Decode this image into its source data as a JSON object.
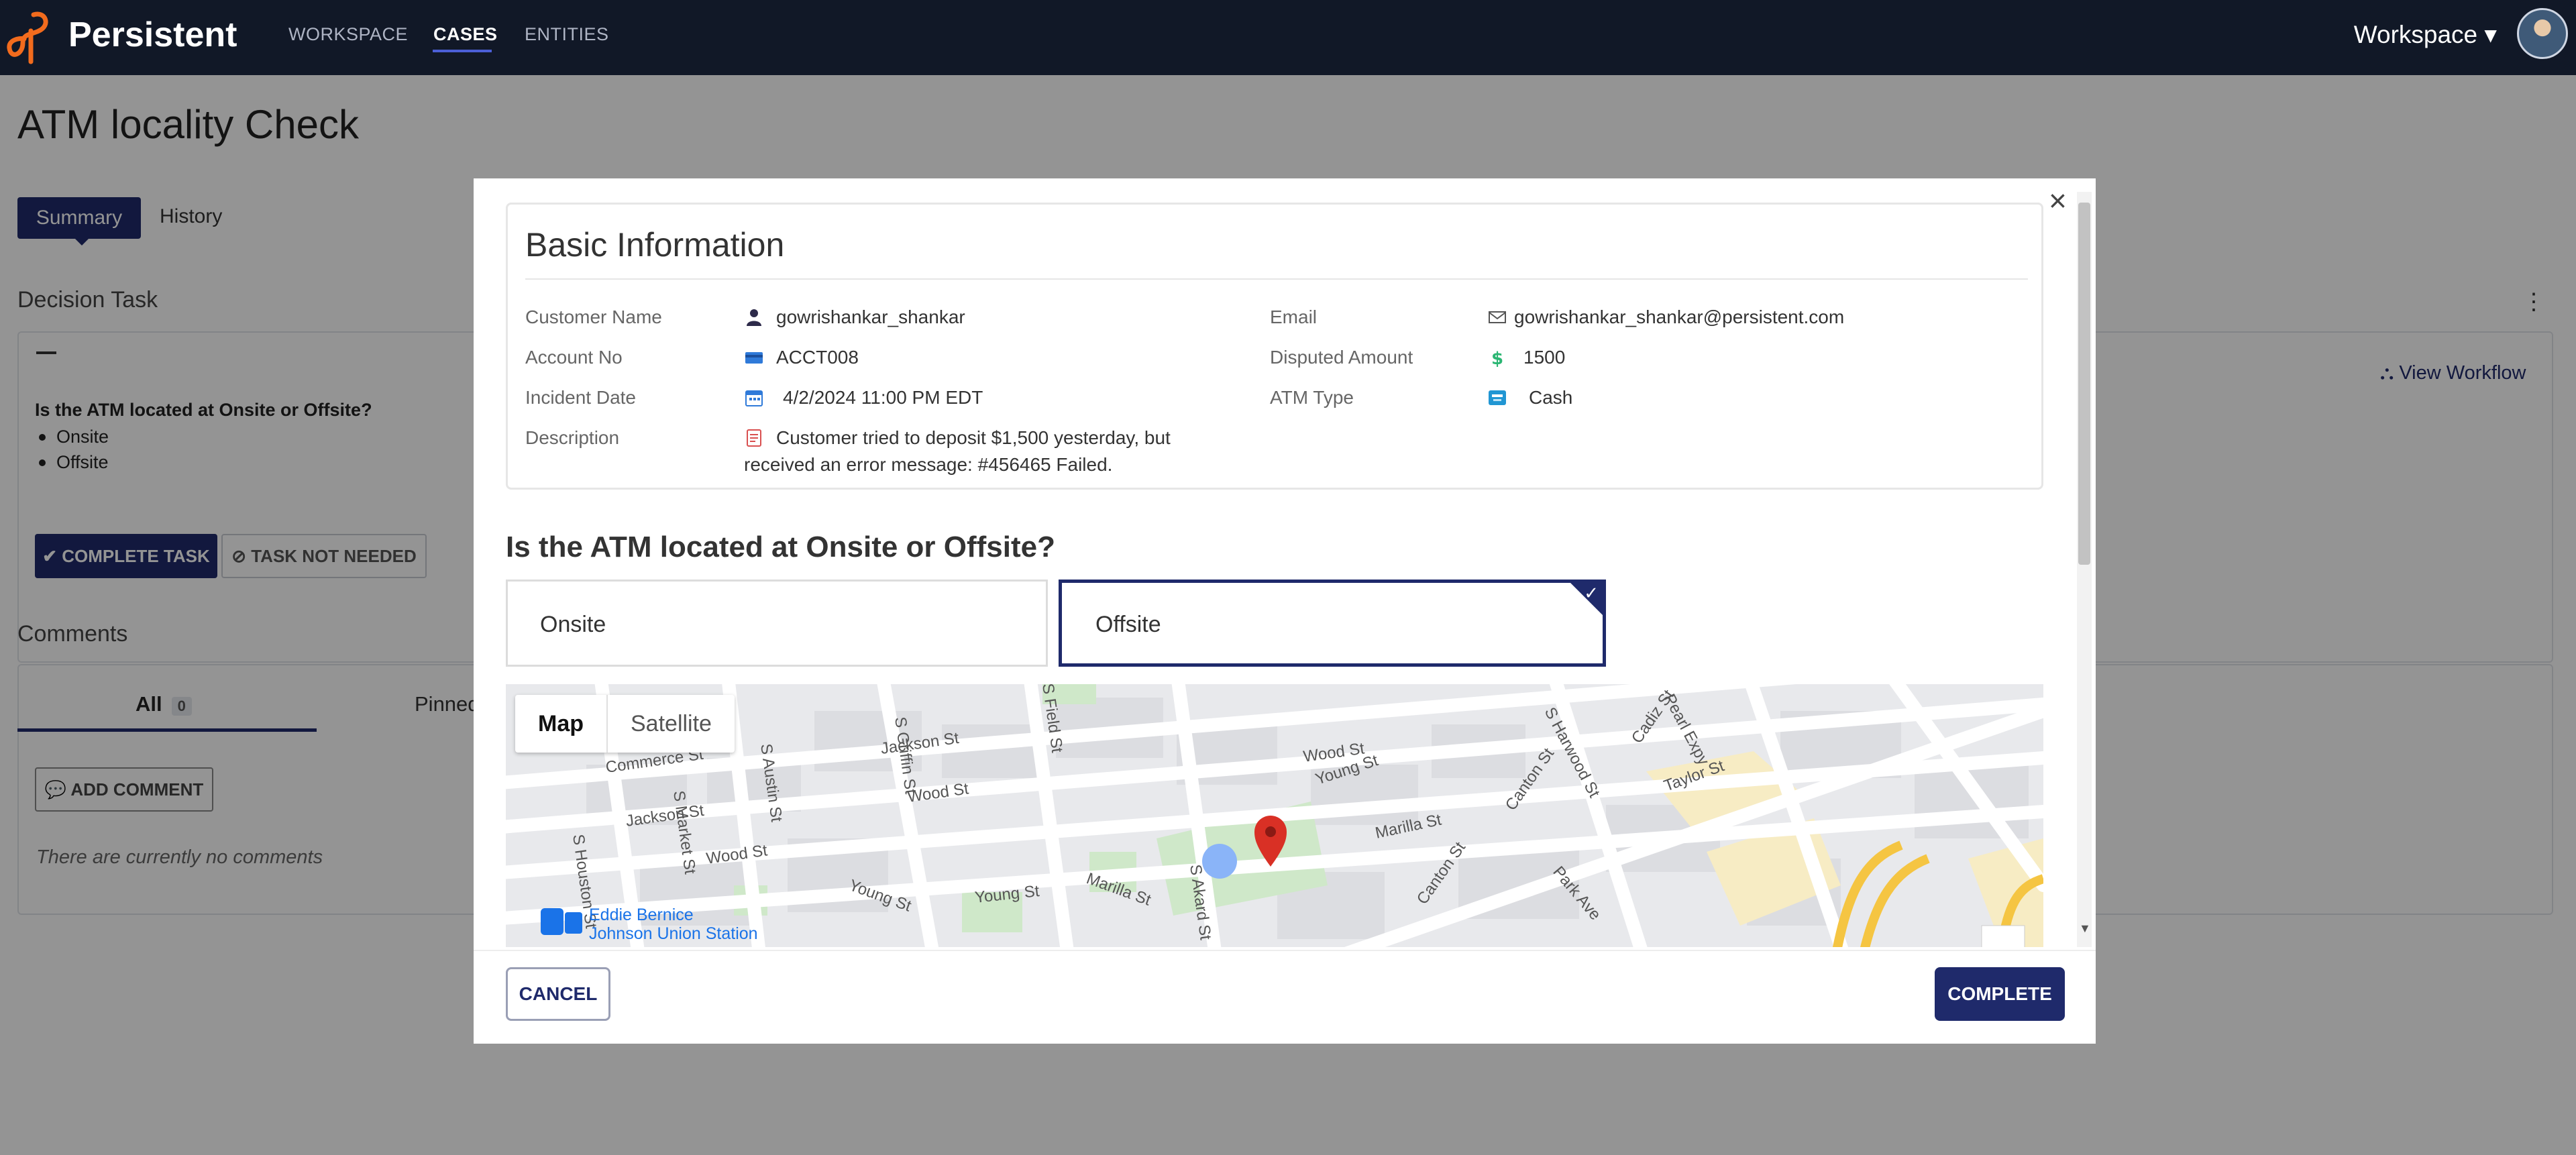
{
  "app": {
    "brand": "Persistent"
  },
  "nav": {
    "items": [
      {
        "label": "WORKSPACE",
        "active": false
      },
      {
        "label": "CASES",
        "active": true
      },
      {
        "label": "ENTITIES",
        "active": false
      }
    ],
    "workspace_menu": "Workspace ▾"
  },
  "page": {
    "title": "ATM locality Check",
    "tabs": [
      "Summary",
      "History"
    ],
    "decision_task": {
      "heading": "Decision Task",
      "question": "Is the ATM located at Onsite or Offsite?",
      "options": [
        "Onsite",
        "Offsite"
      ],
      "complete_button": "✔ COMPLETE TASK",
      "not_needed_button": "⊘ TASK NOT NEEDED",
      "view_workflow": "View Workflow"
    },
    "comments": {
      "heading": "Comments",
      "tabs": {
        "all": "All",
        "all_count": "0",
        "pinned": "Pinned"
      },
      "add_button": "ADD COMMENT",
      "empty_text": "There are currently no comments"
    }
  },
  "modal": {
    "close": "×",
    "basic_info": {
      "title": "Basic Information",
      "fields": {
        "customer_name": {
          "label": "Customer Name",
          "value": "gowrishankar_shankar",
          "icon": "user-icon"
        },
        "account_no": {
          "label": "Account No",
          "value": "ACCT008",
          "icon": "card-icon"
        },
        "incident_date": {
          "label": "Incident Date",
          "value": "4/2/2024 11:00 PM EDT",
          "icon": "calendar-icon"
        },
        "description": {
          "label": "Description",
          "value_line1": "Customer tried to deposit $1,500 yesterday, but",
          "value_line2": "received an error message: #456465 Failed.",
          "icon": "document-icon"
        },
        "email": {
          "label": "Email",
          "value": "gowrishankar_shankar@persistent.com",
          "icon": "mail-icon"
        },
        "disputed_amount": {
          "label": "Disputed Amount",
          "value": "1500",
          "icon": "dollar-icon"
        },
        "atm_type": {
          "label": "ATM Type",
          "value": "Cash",
          "icon": "atm-icon"
        }
      }
    },
    "question": "Is the ATM located at Onsite or Offsite?",
    "options": [
      {
        "label": "Onsite",
        "selected": false
      },
      {
        "label": "Offsite",
        "selected": true
      }
    ],
    "map": {
      "toggle": [
        "Map",
        "Satellite"
      ],
      "active": "Map",
      "streets": [
        "Commerce St",
        "Jackson St",
        "Wood St",
        "Young St",
        "S Houston St",
        "S Market St",
        "S Austin St",
        "S Griffin St",
        "S Field St",
        "S Akard St",
        "Marilla St",
        "Canton St",
        "S Harwood St",
        "Cadiz St",
        "Pearl Expy",
        "Taylor St",
        "Park Ave"
      ],
      "station": "Eddie Bernice Johnson Union Station"
    },
    "cancel": "CANCEL",
    "complete": "COMPLETE"
  },
  "colors": {
    "primary": "#1f2a6b",
    "navbar": "#111827",
    "accent": "#f26b1d",
    "pin": "#d93025"
  }
}
